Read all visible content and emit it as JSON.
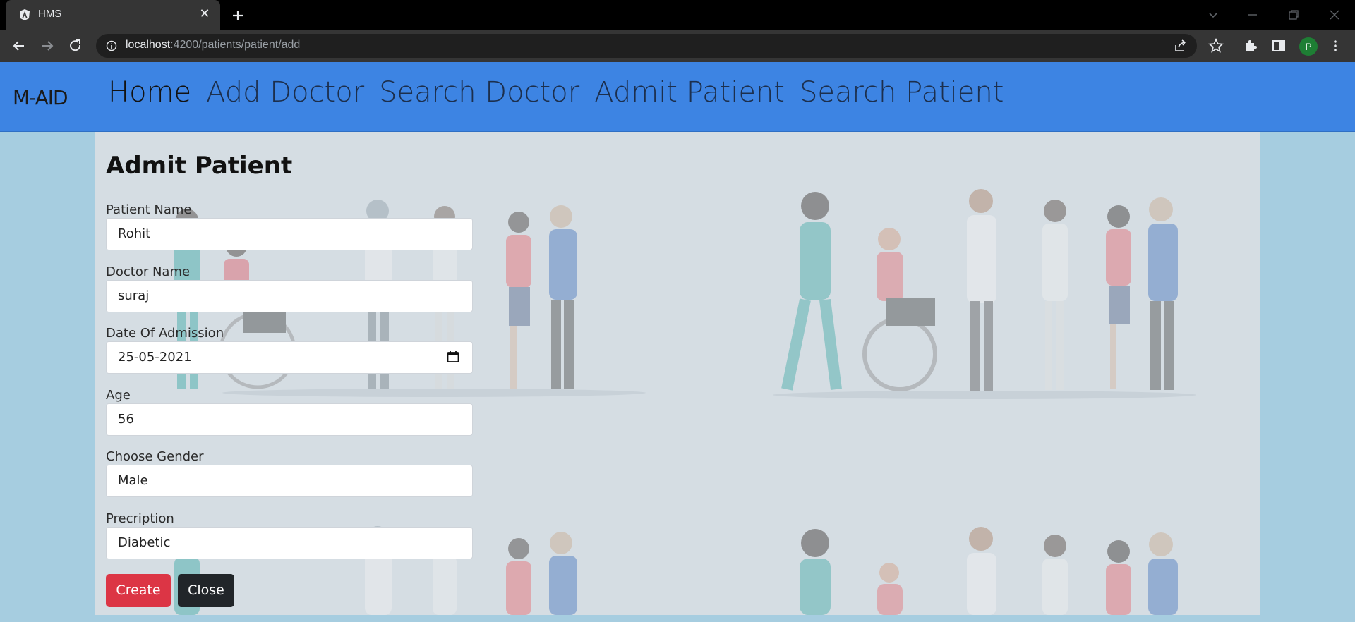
{
  "browser": {
    "tab_title": "HMS",
    "url_host": "localhost",
    "url_path": ":4200/patients/patient/add",
    "profile_initial": "P"
  },
  "navbar": {
    "brand": "M-AID",
    "links": [
      "Home",
      "Add Doctor",
      "Search Doctor",
      "Admit Patient",
      "Search Patient"
    ]
  },
  "form": {
    "title": "Admit Patient",
    "fields": [
      {
        "label": "Patient Name",
        "value": "Rohit"
      },
      {
        "label": "Doctor Name",
        "value": "suraj"
      },
      {
        "label": "Date Of Admission",
        "value": "25-05-2021"
      },
      {
        "label": "Age",
        "value": "56"
      },
      {
        "label": "Choose Gender",
        "value": "Male"
      },
      {
        "label": "Precription",
        "value": "Diabetic"
      }
    ],
    "create_label": "Create",
    "close_label": "Close"
  },
  "colors": {
    "navbar": "#3d84e3",
    "page_bg": "#a6cde0",
    "panel": "#d5dde3",
    "create_btn": "#dc3545",
    "close_btn": "#212529"
  }
}
